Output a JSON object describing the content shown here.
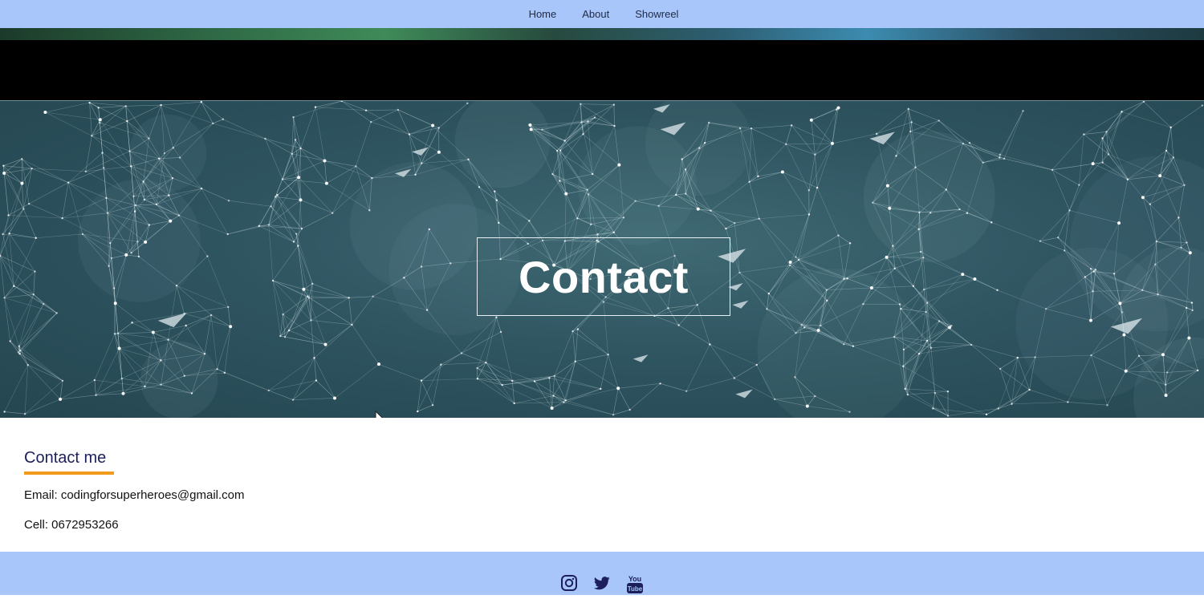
{
  "nav": {
    "items": [
      {
        "label": "Home"
      },
      {
        "label": "About"
      },
      {
        "label": "Showreel"
      }
    ]
  },
  "hero": {
    "title": "Contact"
  },
  "contact": {
    "heading": "Contact me",
    "email_line": "Email: codingforsuperheroes@gmail.com",
    "cell_line": "Cell: 0672953266"
  },
  "footer": {
    "icons": [
      "instagram-icon",
      "twitter-icon",
      "youtube-icon"
    ],
    "youtube_text_top": "You",
    "youtube_text_bottom": "Tube"
  },
  "colors": {
    "nav_bg": "#a9c6fb",
    "heading": "#1c1f5a",
    "accent_underline": "#f09a1e",
    "hero_bg": "#2f5561"
  }
}
